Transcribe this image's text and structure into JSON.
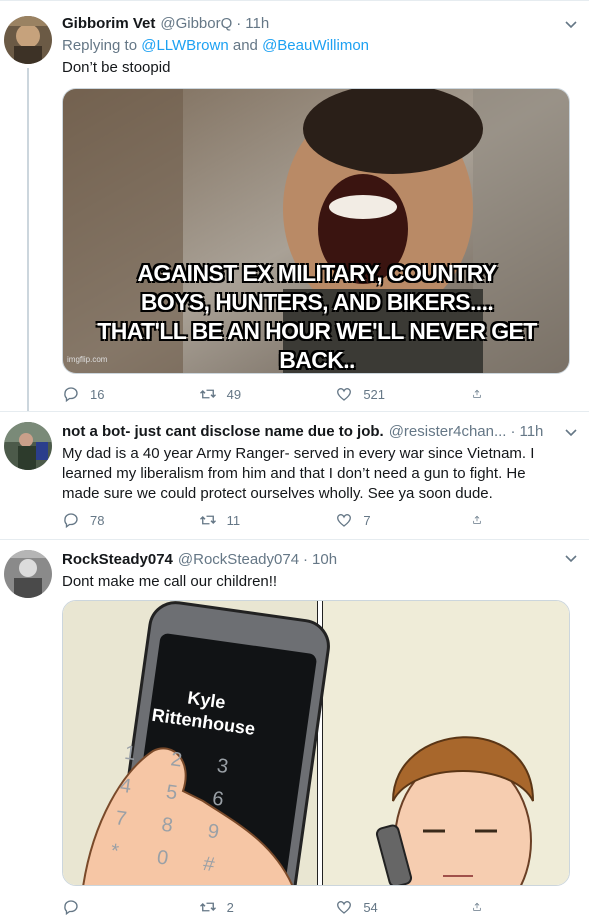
{
  "tweets": [
    {
      "avatar_icon": "user-avatar",
      "name": "Gibborim Vet",
      "handle": "@GibborQ",
      "time": "11h",
      "reply_prefix": "Replying to ",
      "reply_users": [
        "@LLWBrown",
        "@BeauWillimon"
      ],
      "reply_joiner": " and ",
      "text": "Don’t be stoopid",
      "media": {
        "caption_lines": [
          "AGAINST EX MILITARY, COUNTRY",
          "BOYS, HUNTERS, AND BIKERS....",
          "THAT'LL BE AN HOUR WE'LL NEVER GET BACK.."
        ],
        "watermark": "imgflip.com"
      },
      "stats": {
        "replies": "16",
        "retweets": "49",
        "likes": "521"
      }
    },
    {
      "avatar_icon": "user-avatar",
      "name": "not a bot- just cant disclose name due to job.",
      "handle": "@resister4chan...",
      "time": "11h",
      "text": "My dad is a 40 year Army Ranger- served in every war since Vietnam. I learned my liberalism from him and that I don’t need a gun to fight. He made sure we could protect ourselves wholly. See ya soon dude.",
      "stats": {
        "replies": "78",
        "retweets": "11",
        "likes": "7"
      }
    },
    {
      "avatar_icon": "user-avatar",
      "name": "RockSteady074",
      "handle": "@RockSteady074",
      "time": "10h",
      "text": "Dont make me call our children!!",
      "media": {
        "phone_label_line1": "Kyle",
        "phone_label_line2": "Rittenhouse",
        "keypad": [
          "1",
          "2",
          "3",
          "4",
          "5",
          "6",
          "7",
          "8",
          "9",
          "*",
          "0",
          "#"
        ]
      },
      "stats": {
        "replies": "",
        "retweets": "2",
        "likes": "54"
      }
    }
  ],
  "colors": {
    "accent": "#1da1f2",
    "secondary_text": "#657786",
    "border": "#e6ecf0"
  },
  "icons": {
    "reply": "reply-icon",
    "retweet": "retweet-icon",
    "like": "heart-icon",
    "share": "share-icon",
    "caret": "chevron-down-icon"
  }
}
